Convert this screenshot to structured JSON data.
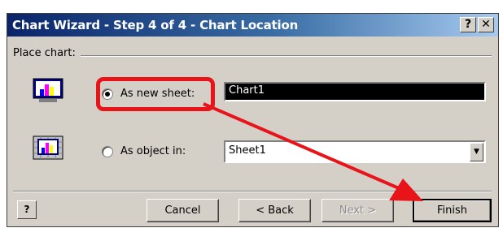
{
  "window": {
    "title": "Chart Wizard - Step 4 of 4 - Chart Location",
    "help_glyph": "?",
    "close_glyph": "✕"
  },
  "group": {
    "label": "Place chart:"
  },
  "options": [
    {
      "label": "As new sheet:",
      "selected": true,
      "value": "Chart1",
      "icon": "chart-sheet-icon"
    },
    {
      "label": "As object in:",
      "selected": false,
      "value": "Sheet1",
      "icon": "embedded-chart-icon"
    }
  ],
  "buttons": {
    "help_icon": "office-assistant-icon",
    "cancel": "Cancel",
    "back": "< Back",
    "next": "Next >",
    "finish": "Finish"
  },
  "annotation": {
    "color": "#e8141a"
  },
  "dropdown_glyph": "▼"
}
